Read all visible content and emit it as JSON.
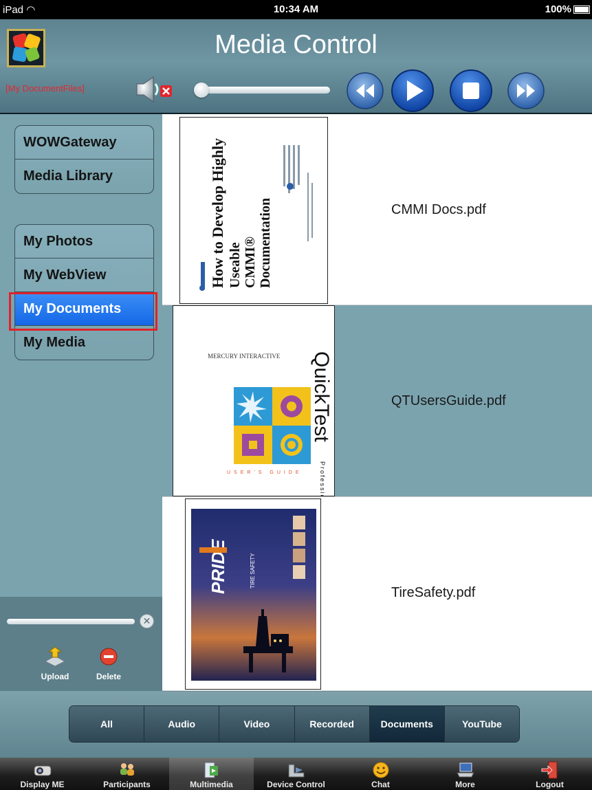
{
  "status_bar": {
    "carrier": "iPad",
    "time": "10:34 AM",
    "battery": "100%"
  },
  "header": {
    "title": "Media Control",
    "current_folder": "[My DocumentFiles]",
    "icons": [
      "app-logo",
      "speaker-muted-icon",
      "rewind-icon",
      "play-icon",
      "stop-icon",
      "fast-forward-icon"
    ]
  },
  "sidebar": {
    "group1": [
      "WOWGateway",
      "Media Library"
    ],
    "group2": [
      "My Photos",
      "My WebView",
      "My Documents",
      "My Media"
    ],
    "selected": "My Documents",
    "actions": {
      "upload": "Upload",
      "delete": "Delete"
    }
  },
  "documents": [
    {
      "name": "CMMI Docs.pdf",
      "thumb_title": "How to Develop Highly Useable CMMI® Documentation",
      "thumb_line1": "How to Develop Highly",
      "thumb_line2": "Useable",
      "thumb_line3": "CMMI®",
      "thumb_line4": "Documentation"
    },
    {
      "name": "QTUsersGuide.pdf",
      "thumb_brand": "MERCURY INTERACTIVE",
      "thumb_title": "QuickTest",
      "thumb_subtitle": "Professional",
      "thumb_footer": "USER'S GUIDE"
    },
    {
      "name": "TireSafety.pdf",
      "thumb_brand": "PRIDE",
      "thumb_subtitle": "TIRE SAFETY"
    }
  ],
  "filters": {
    "items": [
      "All",
      "Audio",
      "Video",
      "Recorded",
      "Documents",
      "YouTube"
    ],
    "active": "Documents"
  },
  "tabbar": {
    "items": [
      "Display ME",
      "Participants",
      "Multimedia",
      "Device Control",
      "Chat",
      "More",
      "Logout"
    ],
    "active": "Multimedia"
  },
  "colors": {
    "accent_blue": "#1567e8",
    "highlight_red": "#e1222a",
    "panel_teal": "#7aa3ae",
    "folder_label_red": "#e5272e"
  }
}
